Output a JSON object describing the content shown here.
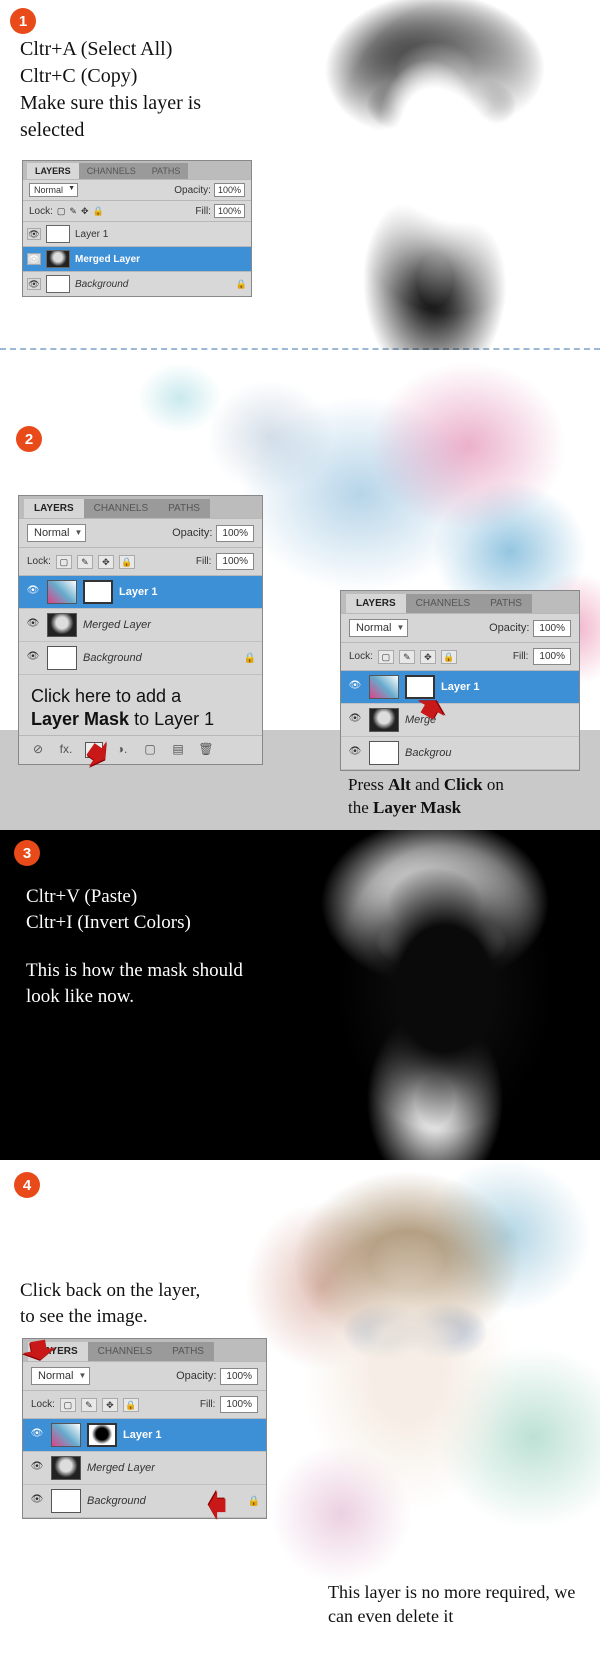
{
  "steps": {
    "s1": {
      "num": "1",
      "line1": "Cltr+A (Select All)",
      "line2": "Cltr+C (Copy)",
      "line3": "Make sure this layer is",
      "line4": "selected"
    },
    "s2": {
      "num": "2",
      "captionA_l1": "Click here to add a",
      "captionA_l2_b": "Layer Mask",
      "captionA_l2_rest": " to Layer 1",
      "captionB_l1_a": "Press ",
      "captionB_l1_b1": "Alt",
      "captionB_l1_mid": " and ",
      "captionB_l1_b2": "Click",
      "captionB_l1_end": " on",
      "captionB_l2_a": "the ",
      "captionB_l2_b": "Layer Mask"
    },
    "s3": {
      "num": "3",
      "line1": "Cltr+V (Paste)",
      "line2": "Cltr+I (Invert Colors)",
      "line3": "This is how the mask should look like now."
    },
    "s4": {
      "num": "4",
      "instr_l1": "Click back on the layer,",
      "instr_l2": "to see the image.",
      "cap2": "This layer is no more required, we can even delete it"
    }
  },
  "panel": {
    "tabs": {
      "layers": "LAYERS",
      "channels": "CHANNELS",
      "paths": "PATHS"
    },
    "blend": "Normal",
    "opacity_label": "Opacity:",
    "opacity_val": "100%",
    "lock_label": "Lock:",
    "fill_label": "Fill:",
    "fill_val": "100%",
    "layers": {
      "layer1": "Layer 1",
      "merged": "Merged Layer",
      "background": "Background"
    },
    "footer_icons": [
      "⊘",
      "fx.",
      "◐",
      "◑.",
      "▢",
      "▤",
      "🗑"
    ]
  }
}
